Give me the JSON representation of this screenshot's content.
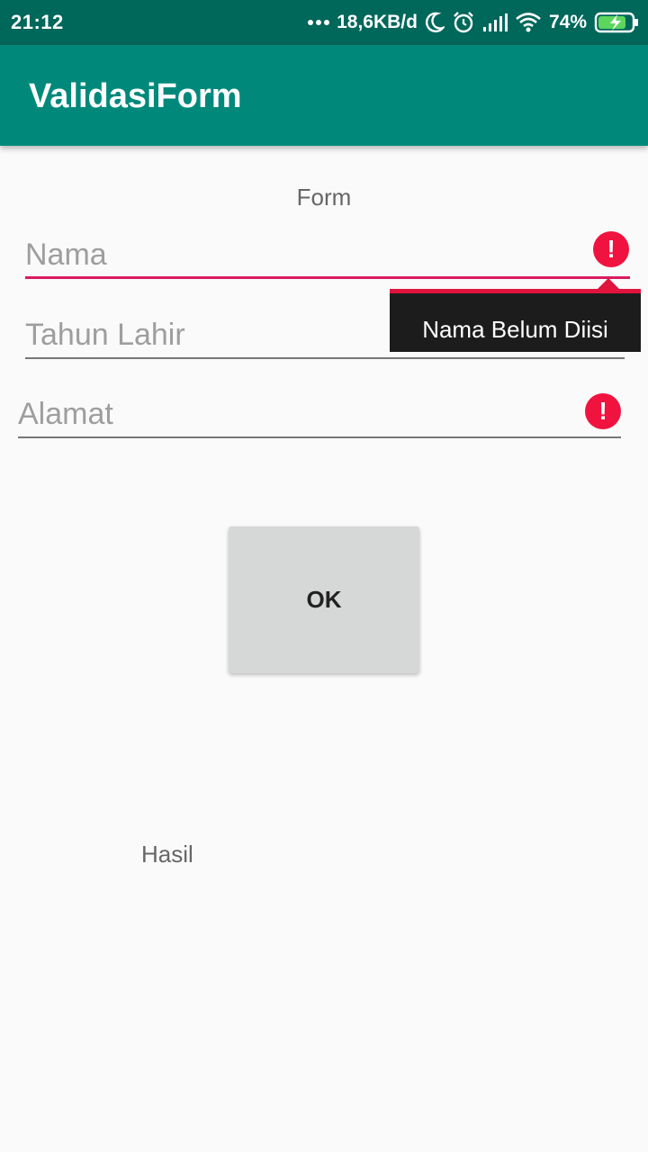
{
  "status_bar": {
    "time": "21:12",
    "net_speed": "18,6KB/d",
    "battery_percent": "74%",
    "icons": [
      "more-dots-icon",
      "moon-icon",
      "alarm-icon",
      "signal-icon",
      "wifi-icon",
      "battery-charging-icon"
    ]
  },
  "app_bar": {
    "title": "ValidasiForm"
  },
  "form": {
    "label": "Form",
    "fields": {
      "nama": {
        "placeholder": "Nama",
        "value": "",
        "error": "Nama Belum Diisi"
      },
      "tahun_lahir": {
        "placeholder": "Tahun Lahir",
        "value": ""
      },
      "alamat": {
        "placeholder": "Alamat",
        "value": ""
      }
    },
    "error_glyph": "!",
    "ok_label": "OK",
    "result_label": "Hasil"
  },
  "colors": {
    "app_bar": "#00897b",
    "status_bar": "#00675b",
    "error": "#f0133f",
    "underline_error": "#d81b60"
  }
}
